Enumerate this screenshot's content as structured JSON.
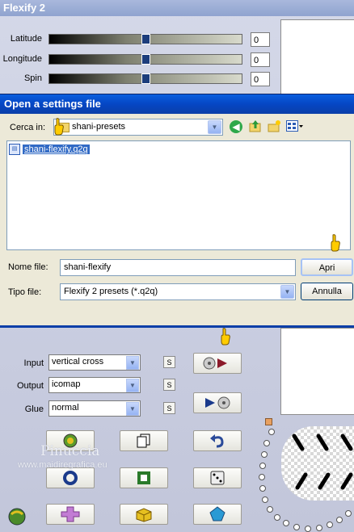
{
  "flexify": {
    "title": "Flexify 2",
    "sliders": [
      {
        "label": "Latitude",
        "value": "0"
      },
      {
        "label": "Longitude",
        "value": "0"
      },
      {
        "label": "Spin",
        "value": "0"
      }
    ],
    "input": {
      "label": "Input",
      "value": "vertical cross"
    },
    "output": {
      "label": "Output",
      "value": "icomap"
    },
    "glue": {
      "label": "Glue",
      "value": "normal"
    },
    "s_label": "S"
  },
  "dialog": {
    "title": "Open a settings file",
    "look_in_label": "Cerca in:",
    "look_in_value": "shani-presets",
    "files": [
      {
        "name": "shani-flexify.q2q",
        "selected": true
      }
    ],
    "filename_label": "Nome file:",
    "filename_value": "shani-flexify",
    "filetype_label": "Tipo file:",
    "filetype_value": "Flexify 2 presets (*.q2q)",
    "open_button": "Apri",
    "cancel_button": "Annulla"
  },
  "watermark": {
    "line1": "Pinuccia",
    "line2": "www.maidiregrafica.eu"
  },
  "colors": {
    "xp_blue": "#0a5ede",
    "selection": "#316ac5",
    "accent": "#ffcc00"
  }
}
